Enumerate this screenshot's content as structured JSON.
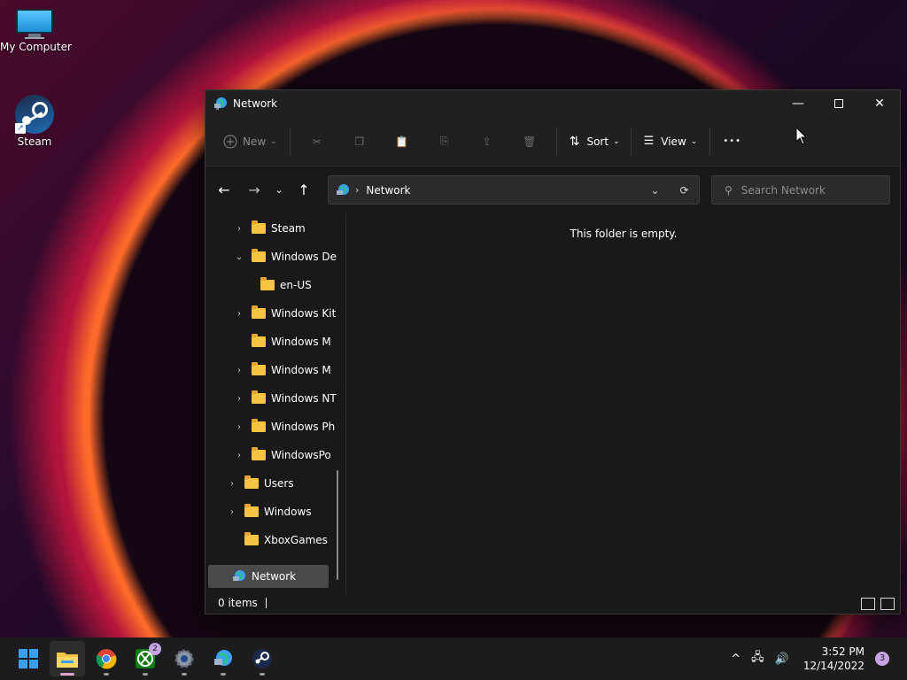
{
  "desktop": {
    "icons": [
      {
        "label": "My Computer"
      },
      {
        "label": "Steam"
      }
    ]
  },
  "window": {
    "title": "Network",
    "toolbar": {
      "new_label": "New",
      "sort_label": "Sort",
      "view_label": "View",
      "more_label": "•••"
    },
    "address": {
      "crumb": "Network",
      "search_placeholder": "Search Network"
    },
    "tree": [
      {
        "label": "Steam",
        "expander": "›"
      },
      {
        "label": "Windows De",
        "expander": "⌄"
      },
      {
        "label": "en-US",
        "expander": ""
      },
      {
        "label": "Windows Kit",
        "expander": "›"
      },
      {
        "label": "Windows M",
        "expander": ""
      },
      {
        "label": "Windows M",
        "expander": "›"
      },
      {
        "label": "Windows NT",
        "expander": "›"
      },
      {
        "label": "Windows Ph",
        "expander": "›"
      },
      {
        "label": "WindowsPo",
        "expander": "›"
      },
      {
        "label": "Users",
        "expander": "›"
      },
      {
        "label": "Windows",
        "expander": "›"
      },
      {
        "label": "XboxGames",
        "expander": ""
      },
      {
        "label": "Network",
        "expander": ""
      }
    ],
    "empty_message": "This folder is empty.",
    "status": "0 items"
  },
  "taskbar": {
    "apps": [
      {
        "name": "start",
        "badge": ""
      },
      {
        "name": "file-explorer",
        "badge": ""
      },
      {
        "name": "chrome",
        "badge": ""
      },
      {
        "name": "xbox",
        "badge": "2"
      },
      {
        "name": "settings",
        "badge": ""
      },
      {
        "name": "network-app",
        "badge": ""
      },
      {
        "name": "steam",
        "badge": ""
      }
    ],
    "time": "3:52 PM",
    "date": "12/14/2022",
    "notifications": "3",
    "tray_chevron": "^"
  },
  "colors": {
    "accent": "#3aa0ff",
    "folder": "#f6c443",
    "window_bg": "#191919",
    "taskbar_bg": "#1c1c1c"
  }
}
